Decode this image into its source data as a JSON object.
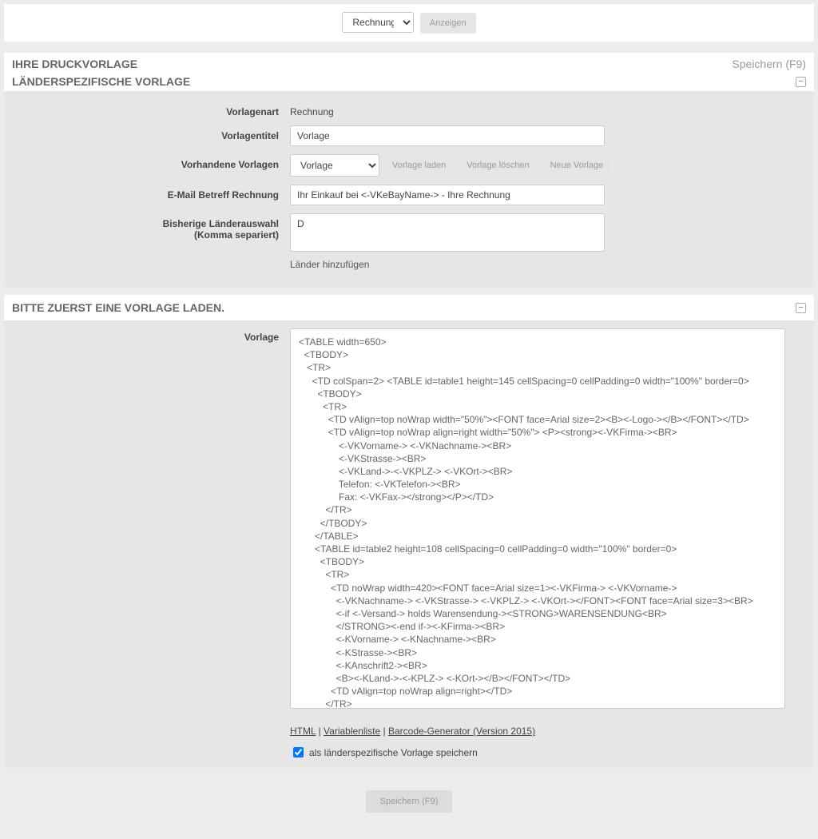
{
  "topbar": {
    "type_select_value": "Rechnung",
    "show_button": "Anzeigen"
  },
  "section1": {
    "title": "IHRE DRUCKVORLAGE",
    "save_hint": "Speichern (F9)",
    "subtitle": "LÄNDERSPEZIFISCHE VORLAGE",
    "labels": {
      "vorlagenart": "Vorlagenart",
      "vorlagentitel": "Vorlagentitel",
      "vorhandene": "Vorhandene Vorlagen",
      "email": "E-Mail Betreff Rechnung",
      "laender": "Bisherige Länderauswahl",
      "laender_sub": "(Komma separiert)"
    },
    "values": {
      "vorlagenart": "Rechnung",
      "vorlagentitel": "Vorlage",
      "vorhandene_select": "Vorlage",
      "email": "Ihr Einkauf bei <-VKeBayName-> - Ihre Rechnung",
      "laender": "D",
      "laender_add": "Länder hinzufügen"
    },
    "buttons": {
      "load": "Vorlage laden",
      "delete": "Vorlage löschen",
      "new": "Neue Vorlage"
    }
  },
  "section2": {
    "title": "BITTE ZUERST EINE VORLAGE LADEN.",
    "label": "Vorlage",
    "code": "<TABLE width=650>\n  <TBODY>\n   <TR>\n     <TD colSpan=2> <TABLE id=table1 height=145 cellSpacing=0 cellPadding=0 width=\"100%\" border=0>\n       <TBODY>\n         <TR>\n           <TD vAlign=top noWrap width=\"50%\"><FONT face=Arial size=2><B><-Logo-></B></FONT></TD>\n           <TD vAlign=top noWrap align=right width=\"50%\"> <P><strong><-VKFirma-><BR>\n               <-VKVorname-> <-VKNachname-><BR>\n               <-VKStrasse-><BR>\n               <-VKLand->-<-VKPLZ-> <-VKOrt-><BR>\n               Telefon: <-VKTelefon-><BR>\n               Fax: <-VKFax-></strong></P></TD>\n          </TR>\n        </TBODY>\n      </TABLE>\n      <TABLE id=table2 height=108 cellSpacing=0 cellPadding=0 width=\"100%\" border=0>\n        <TBODY>\n          <TR>\n            <TD noWrap width=420><FONT face=Arial size=1><-VKFirma-> <-VKVorname->\n              <-VKNachname-> <-VKStrasse-> <-VKPLZ-> <-VKOrt-></FONT><FONT face=Arial size=3><BR>\n              <-if <-Versand-> holds Warensendung-><STRONG>WARENSENDUNG<BR>\n              </STRONG><-end if-><-KFirma-><BR>\n              <-KVorname-> <-KNachname-><BR>\n              <-KStrasse-><BR>\n              <-KAnschrift2-><BR>\n              <B><-KLand->-<-KPLZ-> <-KOrt-></B></FONT></TD>\n            <TD vAlign=top noWrap align=right></TD>\n          </TR>\n        </TBODY>",
    "links": {
      "html": "HTML",
      "variablen": "Variablenliste",
      "barcode": "Barcode-Generator (Version 2015)"
    },
    "checkbox_label": "als länderspezifische Vorlage speichern"
  },
  "footer": {
    "save_button": "Speichern (F9)"
  }
}
